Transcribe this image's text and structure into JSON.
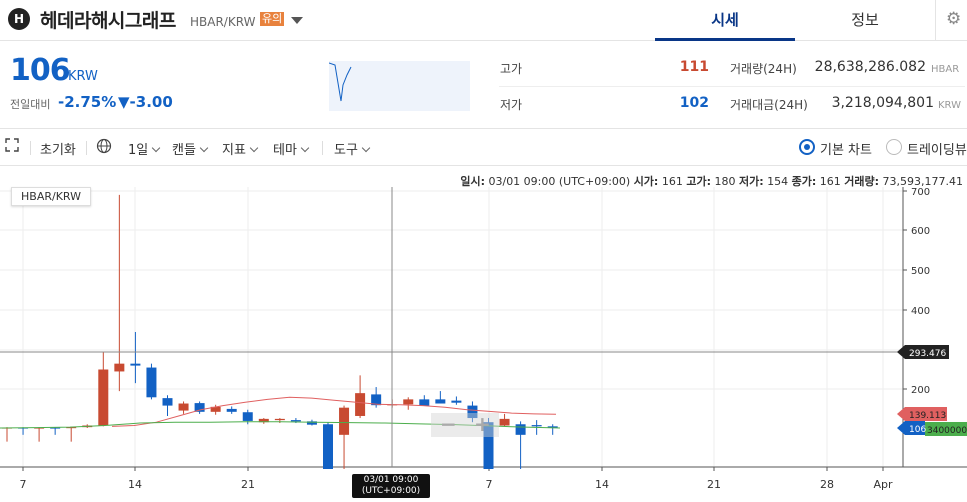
{
  "header": {
    "logo_letter": "H",
    "coin_name": "헤데라해시그래프",
    "pair": "HBAR/KRW",
    "warning_badge": "유의",
    "tabs": [
      {
        "label": "시세",
        "active": true
      },
      {
        "label": "정보",
        "active": false
      }
    ],
    "settings_icon": "gear-icon"
  },
  "summary": {
    "price": "106",
    "unit": "KRW",
    "change_label": "전일대비",
    "change_rate": "-2.75%",
    "change_amount": "▼-3.00",
    "high_label": "고가",
    "high_value": "111",
    "low_label": "저가",
    "low_value": "102",
    "volume_label": "거래량(24H)",
    "volume_value": "28,638,286.082",
    "volume_unit": "HBAR",
    "amount_label": "거래대금(24H)",
    "amount_value": "3,218,094,801",
    "amount_unit": "KRW",
    "colors": {
      "up": "#c84a31",
      "down": "#1261c4"
    }
  },
  "toolbar": {
    "reset": "초기화",
    "interval": "1일",
    "candle": "캔들",
    "indicator": "지표",
    "theme": "테마",
    "tools": "도구",
    "basic_chart": "기본 차트",
    "trading_view": "트레이딩뷰",
    "icons": [
      "expand-icon",
      "globe-icon"
    ]
  },
  "chart": {
    "pair_label": "HBAR/KRW",
    "info": {
      "date_label": "일시:",
      "date_value": "03/01 09:00 (UTC+09:00)",
      "open_label": "시가:",
      "open_value": "161",
      "high_label": "고가:",
      "high_value": "180",
      "low_label": "저가:",
      "low_value": "154",
      "close_label": "종가:",
      "close_value": "161",
      "volume_label": "거래량:",
      "volume_value": "73,593,177.41"
    },
    "zoom_minus": "−",
    "zoom_plus": "+",
    "crosshair_date": "03/01 09:00",
    "crosshair_tz": "(UTC+09:00)",
    "crosshair_price": "293.476",
    "ma_red_label": "139.113",
    "current_price_label": "106",
    "ma_green_label": "3400000"
  },
  "chart_data": {
    "type": "candlestick",
    "y_ticks": [
      200,
      300,
      400,
      500,
      600,
      700
    ],
    "x_ticks": [
      "7",
      "14",
      "21",
      "7",
      "14",
      "21",
      "28",
      "Apr"
    ],
    "ylim": [
      100,
      710
    ],
    "candles": [
      {
        "open": 106,
        "high": 108,
        "low": 104,
        "close": 107
      },
      {
        "open": 107,
        "high": 108,
        "low": 105,
        "close": 106
      },
      {
        "open": 106,
        "high": 108,
        "low": 104,
        "close": 107
      },
      {
        "open": 107,
        "high": 108,
        "low": 105,
        "close": 106
      },
      {
        "open": 106,
        "high": 109,
        "low": 104,
        "close": 108
      },
      {
        "open": 108,
        "high": 115,
        "low": 106,
        "close": 112
      },
      {
        "open": 112,
        "high": 295,
        "low": 110,
        "close": 250
      },
      {
        "open": 245,
        "high": 690,
        "low": 195,
        "close": 265
      },
      {
        "open": 265,
        "high": 345,
        "low": 215,
        "close": 260
      },
      {
        "open": 255,
        "high": 265,
        "low": 175,
        "close": 180
      },
      {
        "open": 178,
        "high": 185,
        "low": 135,
        "close": 160
      },
      {
        "open": 148,
        "high": 170,
        "low": 140,
        "close": 165
      },
      {
        "open": 166,
        "high": 170,
        "low": 140,
        "close": 145
      },
      {
        "open": 145,
        "high": 162,
        "low": 138,
        "close": 157
      },
      {
        "open": 152,
        "high": 158,
        "low": 140,
        "close": 145
      },
      {
        "open": 144,
        "high": 150,
        "low": 115,
        "close": 123
      },
      {
        "open": 120,
        "high": 130,
        "low": 116,
        "close": 128
      },
      {
        "open": 125,
        "high": 130,
        "low": 118,
        "close": 128
      },
      {
        "open": 125,
        "high": 130,
        "low": 118,
        "close": 122
      },
      {
        "open": 122,
        "high": 126,
        "low": 112,
        "close": 114
      },
      {
        "open": 115,
        "high": 120,
        "low": 96,
        "close": 99
      },
      {
        "open": 105,
        "high": 160,
        "low": 100,
        "close": 155
      },
      {
        "open": 135,
        "high": 235,
        "low": 130,
        "close": 190
      },
      {
        "open": 187,
        "high": 205,
        "low": 155,
        "close": 161
      },
      {
        "open": 163,
        "high": 175,
        "low": 155,
        "close": 163
      },
      {
        "open": 163,
        "high": 180,
        "low": 150,
        "close": 175
      },
      {
        "open": 175,
        "high": 185,
        "low": 160,
        "close": 160
      },
      {
        "open": 175,
        "high": 195,
        "low": 165,
        "close": 165
      },
      {
        "open": 172,
        "high": 182,
        "low": 162,
        "close": 167
      },
      {
        "open": 160,
        "high": 170,
        "low": 120,
        "close": 130
      },
      {
        "open": 120,
        "high": 130,
        "low": 95,
        "close": 100
      },
      {
        "open": 112,
        "high": 140,
        "low": 110,
        "close": 128
      },
      {
        "open": 115,
        "high": 122,
        "low": 100,
        "close": 105
      },
      {
        "open": 113,
        "high": 125,
        "low": 105,
        "close": 110
      },
      {
        "open": 110,
        "high": 115,
        "low": 105,
        "close": 106
      }
    ],
    "ma_red": [
      110,
      112,
      120,
      135,
      150,
      160,
      168,
      175,
      180,
      178,
      173,
      168,
      163,
      162,
      160,
      156,
      150,
      146,
      142,
      140,
      139
    ],
    "ma_green": [
      106,
      107,
      108,
      112,
      118,
      120,
      120,
      121,
      121,
      120,
      119,
      118,
      116,
      114,
      111,
      108,
      106
    ]
  }
}
